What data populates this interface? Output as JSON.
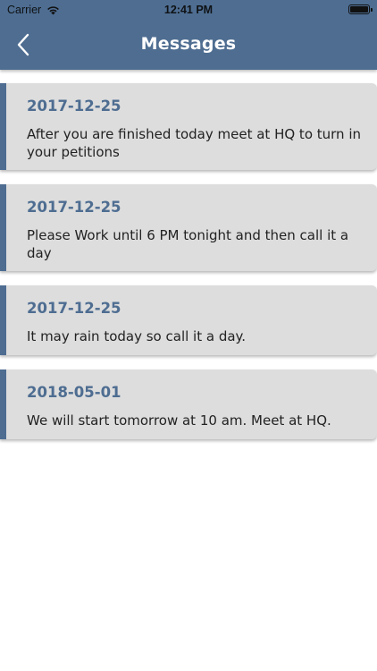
{
  "status_bar": {
    "carrier": "Carrier",
    "time": "12:41 PM"
  },
  "header": {
    "title": "Messages"
  },
  "messages": [
    {
      "date": "2017-12-25",
      "text": "After you are finished today meet at HQ to turn in your petitions"
    },
    {
      "date": "2017-12-25",
      "text": "Please Work until 6 PM tonight and then call it a day"
    },
    {
      "date": "2017-12-25",
      "text": "It may rain today so call it a day."
    },
    {
      "date": "2018-05-01",
      "text": "We will start tomorrow at 10 am. Meet at HQ."
    }
  ],
  "colors": {
    "header_bg": "#4e6d91",
    "card_bg": "#dddddd",
    "accent": "#4e6d91"
  }
}
